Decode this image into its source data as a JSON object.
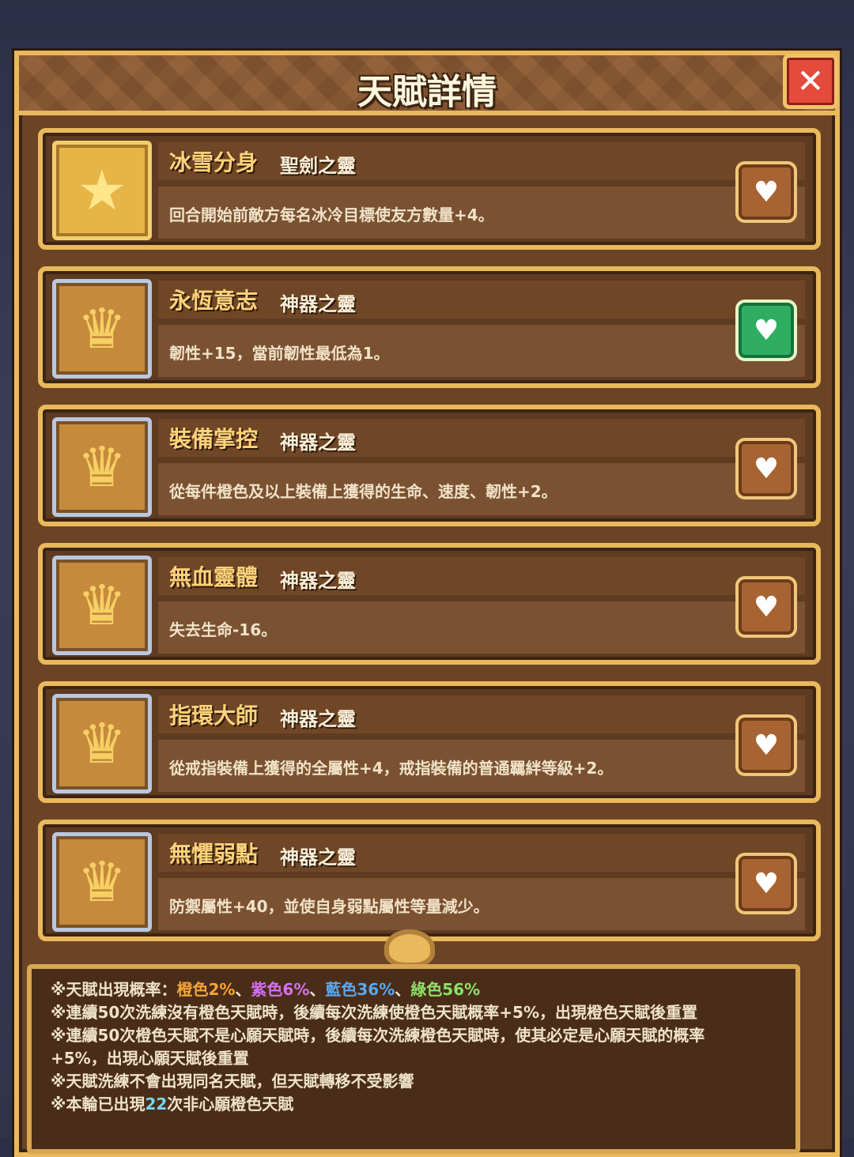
{
  "header": {
    "title": "天賦詳情",
    "close_icon": "close-icon"
  },
  "talents": [
    {
      "name": "冰雪分身",
      "type": "聖劍之靈",
      "desc": "回合開始前敵方每名冰冷目標使友方數量+4。",
      "icon": "star-spirit-icon",
      "favorited": false
    },
    {
      "name": "永恆意志",
      "type": "神器之靈",
      "desc": "韌性+15，當前韌性最低為1。",
      "icon": "artifact-spirit-icon",
      "favorited": true
    },
    {
      "name": "裝備掌控",
      "type": "神器之靈",
      "desc": "從每件橙色及以上裝備上獲得的生命、速度、韌性+2。",
      "icon": "artifact-spirit-icon",
      "favorited": false
    },
    {
      "name": "無血靈體",
      "type": "神器之靈",
      "desc": "失去生命-16。",
      "icon": "artifact-spirit-icon",
      "favorited": false
    },
    {
      "name": "指環大師",
      "type": "神器之靈",
      "desc": "從戒指裝備上獲得的全屬性+4，戒指裝備的普通羈絆等級+2。",
      "icon": "artifact-spirit-icon",
      "favorited": false
    },
    {
      "name": "無懼弱點",
      "type": "神器之靈",
      "desc": "防禦屬性+40，並使自身弱點屬性等量減少。",
      "icon": "artifact-spirit-icon",
      "favorited": false
    }
  ],
  "notes": {
    "rate_prefix": "※天賦出現概率：",
    "orange": "橙色2%",
    "sep": "、",
    "purple": "紫色6%",
    "blue": "藍色36%",
    "green": "綠色56%",
    "line2": "※連續50次洗練沒有橙色天賦時，後續每次洗練使橙色天賦概率+5%，出現橙色天賦後重置",
    "line3": "※連續50次橙色天賦不是心願天賦時，後續每次洗練橙色天賦時，使其必定是心願天賦的概率",
    "line4": "+5%，出現心願天賦後重置",
    "line5": "※天賦洗練不會出現同名天賦，但天賦轉移不受影響",
    "line6_prefix": "※本輪已出現",
    "line6_count": "22",
    "line6_suffix": "次非心願橙色天賦"
  },
  "colors": {
    "panel": "#6b4426",
    "border": "#e9b95c",
    "active_heart": "#2fae62"
  }
}
